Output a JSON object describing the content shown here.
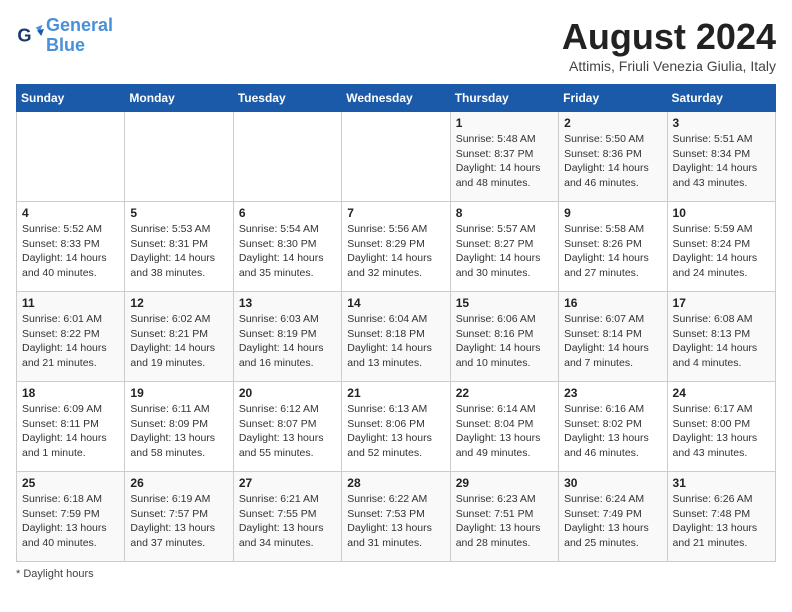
{
  "header": {
    "logo_line1": "General",
    "logo_line2": "Blue",
    "title": "August 2024",
    "subtitle": "Attimis, Friuli Venezia Giulia, Italy"
  },
  "weekdays": [
    "Sunday",
    "Monday",
    "Tuesday",
    "Wednesday",
    "Thursday",
    "Friday",
    "Saturday"
  ],
  "weeks": [
    [
      {
        "day": "",
        "info": ""
      },
      {
        "day": "",
        "info": ""
      },
      {
        "day": "",
        "info": ""
      },
      {
        "day": "",
        "info": ""
      },
      {
        "day": "1",
        "info": "Sunrise: 5:48 AM\nSunset: 8:37 PM\nDaylight: 14 hours\nand 48 minutes."
      },
      {
        "day": "2",
        "info": "Sunrise: 5:50 AM\nSunset: 8:36 PM\nDaylight: 14 hours\nand 46 minutes."
      },
      {
        "day": "3",
        "info": "Sunrise: 5:51 AM\nSunset: 8:34 PM\nDaylight: 14 hours\nand 43 minutes."
      }
    ],
    [
      {
        "day": "4",
        "info": "Sunrise: 5:52 AM\nSunset: 8:33 PM\nDaylight: 14 hours\nand 40 minutes."
      },
      {
        "day": "5",
        "info": "Sunrise: 5:53 AM\nSunset: 8:31 PM\nDaylight: 14 hours\nand 38 minutes."
      },
      {
        "day": "6",
        "info": "Sunrise: 5:54 AM\nSunset: 8:30 PM\nDaylight: 14 hours\nand 35 minutes."
      },
      {
        "day": "7",
        "info": "Sunrise: 5:56 AM\nSunset: 8:29 PM\nDaylight: 14 hours\nand 32 minutes."
      },
      {
        "day": "8",
        "info": "Sunrise: 5:57 AM\nSunset: 8:27 PM\nDaylight: 14 hours\nand 30 minutes."
      },
      {
        "day": "9",
        "info": "Sunrise: 5:58 AM\nSunset: 8:26 PM\nDaylight: 14 hours\nand 27 minutes."
      },
      {
        "day": "10",
        "info": "Sunrise: 5:59 AM\nSunset: 8:24 PM\nDaylight: 14 hours\nand 24 minutes."
      }
    ],
    [
      {
        "day": "11",
        "info": "Sunrise: 6:01 AM\nSunset: 8:22 PM\nDaylight: 14 hours\nand 21 minutes."
      },
      {
        "day": "12",
        "info": "Sunrise: 6:02 AM\nSunset: 8:21 PM\nDaylight: 14 hours\nand 19 minutes."
      },
      {
        "day": "13",
        "info": "Sunrise: 6:03 AM\nSunset: 8:19 PM\nDaylight: 14 hours\nand 16 minutes."
      },
      {
        "day": "14",
        "info": "Sunrise: 6:04 AM\nSunset: 8:18 PM\nDaylight: 14 hours\nand 13 minutes."
      },
      {
        "day": "15",
        "info": "Sunrise: 6:06 AM\nSunset: 8:16 PM\nDaylight: 14 hours\nand 10 minutes."
      },
      {
        "day": "16",
        "info": "Sunrise: 6:07 AM\nSunset: 8:14 PM\nDaylight: 14 hours\nand 7 minutes."
      },
      {
        "day": "17",
        "info": "Sunrise: 6:08 AM\nSunset: 8:13 PM\nDaylight: 14 hours\nand 4 minutes."
      }
    ],
    [
      {
        "day": "18",
        "info": "Sunrise: 6:09 AM\nSunset: 8:11 PM\nDaylight: 14 hours\nand 1 minute."
      },
      {
        "day": "19",
        "info": "Sunrise: 6:11 AM\nSunset: 8:09 PM\nDaylight: 13 hours\nand 58 minutes."
      },
      {
        "day": "20",
        "info": "Sunrise: 6:12 AM\nSunset: 8:07 PM\nDaylight: 13 hours\nand 55 minutes."
      },
      {
        "day": "21",
        "info": "Sunrise: 6:13 AM\nSunset: 8:06 PM\nDaylight: 13 hours\nand 52 minutes."
      },
      {
        "day": "22",
        "info": "Sunrise: 6:14 AM\nSunset: 8:04 PM\nDaylight: 13 hours\nand 49 minutes."
      },
      {
        "day": "23",
        "info": "Sunrise: 6:16 AM\nSunset: 8:02 PM\nDaylight: 13 hours\nand 46 minutes."
      },
      {
        "day": "24",
        "info": "Sunrise: 6:17 AM\nSunset: 8:00 PM\nDaylight: 13 hours\nand 43 minutes."
      }
    ],
    [
      {
        "day": "25",
        "info": "Sunrise: 6:18 AM\nSunset: 7:59 PM\nDaylight: 13 hours\nand 40 minutes."
      },
      {
        "day": "26",
        "info": "Sunrise: 6:19 AM\nSunset: 7:57 PM\nDaylight: 13 hours\nand 37 minutes."
      },
      {
        "day": "27",
        "info": "Sunrise: 6:21 AM\nSunset: 7:55 PM\nDaylight: 13 hours\nand 34 minutes."
      },
      {
        "day": "28",
        "info": "Sunrise: 6:22 AM\nSunset: 7:53 PM\nDaylight: 13 hours\nand 31 minutes."
      },
      {
        "day": "29",
        "info": "Sunrise: 6:23 AM\nSunset: 7:51 PM\nDaylight: 13 hours\nand 28 minutes."
      },
      {
        "day": "30",
        "info": "Sunrise: 6:24 AM\nSunset: 7:49 PM\nDaylight: 13 hours\nand 25 minutes."
      },
      {
        "day": "31",
        "info": "Sunrise: 6:26 AM\nSunset: 7:48 PM\nDaylight: 13 hours\nand 21 minutes."
      }
    ]
  ],
  "footer": {
    "note": "Daylight hours"
  }
}
